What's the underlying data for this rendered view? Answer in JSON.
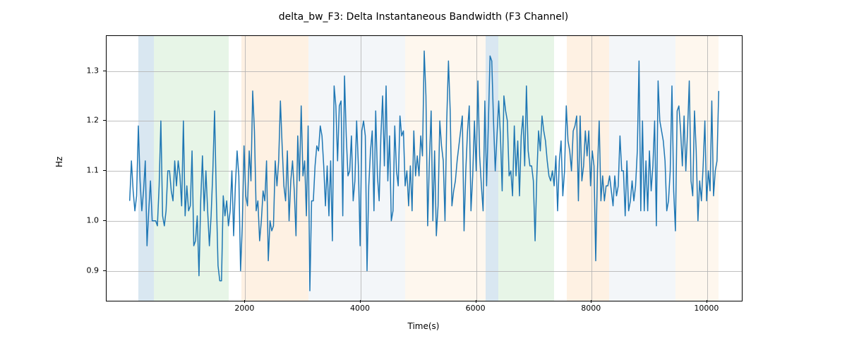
{
  "chart_data": {
    "type": "line",
    "title": "delta_bw_F3: Delta Instantaneous Bandwidth (F3 Channel)",
    "xlabel": "Time(s)",
    "ylabel": "Hz",
    "xlim": [
      -400,
      10600
    ],
    "ylim": [
      0.84,
      1.37
    ],
    "xticks": [
      2000,
      4000,
      6000,
      8000,
      10000
    ],
    "yticks": [
      0.9,
      1.0,
      1.1,
      1.2,
      1.3
    ],
    "bands": [
      {
        "x0": 150,
        "x1": 420,
        "color": "#8ab3d4"
      },
      {
        "x0": 420,
        "x1": 1720,
        "color": "#b3e0b3"
      },
      {
        "x0": 1940,
        "x1": 3100,
        "color": "#fbd4a8"
      },
      {
        "x0": 3100,
        "x1": 4770,
        "color": "#d9e4ed"
      },
      {
        "x0": 4770,
        "x1": 6160,
        "color": "#fce6c9"
      },
      {
        "x0": 6160,
        "x1": 6380,
        "color": "#8ab3d4"
      },
      {
        "x0": 6380,
        "x1": 7350,
        "color": "#b3e0b3"
      },
      {
        "x0": 7570,
        "x1": 8300,
        "color": "#fbd4a8"
      },
      {
        "x0": 8300,
        "x1": 9450,
        "color": "#d9e4ed"
      },
      {
        "x0": 9450,
        "x1": 10200,
        "color": "#fce6c9"
      }
    ],
    "x": [
      0,
      30,
      60,
      90,
      120,
      150,
      180,
      210,
      240,
      270,
      300,
      330,
      360,
      390,
      420,
      450,
      480,
      510,
      540,
      570,
      600,
      630,
      660,
      690,
      720,
      750,
      780,
      810,
      840,
      870,
      900,
      930,
      960,
      990,
      1020,
      1050,
      1080,
      1110,
      1140,
      1170,
      1200,
      1230,
      1260,
      1290,
      1320,
      1350,
      1380,
      1410,
      1440,
      1470,
      1500,
      1530,
      1560,
      1590,
      1620,
      1650,
      1680,
      1710,
      1740,
      1770,
      1800,
      1830,
      1860,
      1890,
      1920,
      1950,
      1980,
      2010,
      2040,
      2070,
      2100,
      2130,
      2160,
      2190,
      2220,
      2250,
      2280,
      2310,
      2340,
      2370,
      2400,
      2430,
      2460,
      2490,
      2520,
      2550,
      2580,
      2610,
      2640,
      2670,
      2700,
      2730,
      2760,
      2790,
      2820,
      2850,
      2880,
      2910,
      2940,
      2970,
      3000,
      3030,
      3060,
      3090,
      3120,
      3150,
      3180,
      3210,
      3240,
      3270,
      3300,
      3330,
      3360,
      3390,
      3420,
      3450,
      3480,
      3510,
      3540,
      3570,
      3600,
      3630,
      3660,
      3690,
      3720,
      3750,
      3780,
      3810,
      3840,
      3870,
      3900,
      3930,
      3960,
      3990,
      4020,
      4050,
      4080,
      4110,
      4140,
      4170,
      4200,
      4230,
      4260,
      4290,
      4320,
      4350,
      4380,
      4410,
      4440,
      4470,
      4500,
      4530,
      4560,
      4590,
      4620,
      4650,
      4680,
      4710,
      4740,
      4770,
      4800,
      4830,
      4860,
      4890,
      4920,
      4950,
      4980,
      5010,
      5040,
      5070,
      5100,
      5130,
      5160,
      5190,
      5220,
      5250,
      5280,
      5310,
      5340,
      5370,
      5400,
      5430,
      5460,
      5490,
      5520,
      5550,
      5580,
      5610,
      5640,
      5670,
      5700,
      5730,
      5760,
      5790,
      5820,
      5850,
      5880,
      5910,
      5940,
      5970,
      6000,
      6030,
      6060,
      6090,
      6120,
      6150,
      6180,
      6210,
      6240,
      6270,
      6300,
      6330,
      6360,
      6390,
      6420,
      6450,
      6480,
      6510,
      6540,
      6570,
      6600,
      6630,
      6660,
      6690,
      6720,
      6750,
      6780,
      6810,
      6840,
      6870,
      6900,
      6930,
      6960,
      6990,
      7020,
      7050,
      7080,
      7110,
      7140,
      7170,
      7200,
      7230,
      7260,
      7290,
      7320,
      7350,
      7380,
      7410,
      7440,
      7470,
      7500,
      7530,
      7560,
      7590,
      7620,
      7650,
      7680,
      7710,
      7740,
      7770,
      7800,
      7830,
      7860,
      7890,
      7920,
      7950,
      7980,
      8010,
      8040,
      8070,
      8100,
      8130,
      8160,
      8190,
      8220,
      8250,
      8280,
      8310,
      8340,
      8370,
      8400,
      8430,
      8460,
      8490,
      8520,
      8550,
      8580,
      8610,
      8640,
      8670,
      8700,
      8730,
      8760,
      8790,
      8820,
      8850,
      8880,
      8910,
      8940,
      8970,
      9000,
      9030,
      9060,
      9090,
      9120,
      9150,
      9180,
      9210,
      9240,
      9270,
      9300,
      9330,
      9360,
      9390,
      9420,
      9450,
      9480,
      9510,
      9540,
      9570,
      9600,
      9630,
      9660,
      9690,
      9720,
      9750,
      9780,
      9810,
      9840,
      9870,
      9900,
      9930,
      9960,
      9990,
      10020,
      10050,
      10080,
      10110,
      10140,
      10170,
      10200
    ],
    "values": [
      1.04,
      1.12,
      1.06,
      1.02,
      1.05,
      1.19,
      1.08,
      1.02,
      1.06,
      1.12,
      0.95,
      1.02,
      1.08,
      1.0,
      1.0,
      1.0,
      0.99,
      1.07,
      1.2,
      1.01,
      0.99,
      1.02,
      1.1,
      1.1,
      1.06,
      1.04,
      1.12,
      1.07,
      1.12,
      1.09,
      1.03,
      1.2,
      1.01,
      1.07,
      1.02,
      1.03,
      1.14,
      0.95,
      0.96,
      1.01,
      0.89,
      1.04,
      1.13,
      1.02,
      1.1,
      1.02,
      0.95,
      1.01,
      1.1,
      1.22,
      1.05,
      0.91,
      0.88,
      0.88,
      1.05,
      1.01,
      1.04,
      0.99,
      1.02,
      1.1,
      0.97,
      1.07,
      1.14,
      1.09,
      0.9,
      0.99,
      1.15,
      1.05,
      1.03,
      1.14,
      1.08,
      1.26,
      1.18,
      1.02,
      1.04,
      0.96,
      1.0,
      1.06,
      1.04,
      1.12,
      0.92,
      1.0,
      0.98,
      0.99,
      1.12,
      1.07,
      1.12,
      1.24,
      1.15,
      1.07,
      1.04,
      1.14,
      1.0,
      1.08,
      1.12,
      1.06,
      0.97,
      1.17,
      1.08,
      1.23,
      1.09,
      1.12,
      1.01,
      1.19,
      0.86,
      1.04,
      1.04,
      1.11,
      1.15,
      1.14,
      1.19,
      1.17,
      1.11,
      1.03,
      1.11,
      1.01,
      1.12,
      0.96,
      1.27,
      1.23,
      1.12,
      1.23,
      1.24,
      1.01,
      1.29,
      1.17,
      1.09,
      1.1,
      1.17,
      1.04,
      1.08,
      1.2,
      1.11,
      0.95,
      1.18,
      1.2,
      1.17,
      0.9,
      1.07,
      1.14,
      1.18,
      1.02,
      1.22,
      1.09,
      1.04,
      1.17,
      1.25,
      1.11,
      1.27,
      1.08,
      1.17,
      1.0,
      1.02,
      1.19,
      1.1,
      1.07,
      1.21,
      1.17,
      1.18,
      1.07,
      1.1,
      1.03,
      1.11,
      1.02,
      1.18,
      1.09,
      1.13,
      1.09,
      1.17,
      1.13,
      1.34,
      1.25,
      0.99,
      1.12,
      1.22,
      1.0,
      1.14,
      0.97,
      1.03,
      1.2,
      1.15,
      1.12,
      1.0,
      1.2,
      1.32,
      1.22,
      1.03,
      1.06,
      1.08,
      1.12,
      1.15,
      1.18,
      1.21,
      0.98,
      1.1,
      1.18,
      1.23,
      1.02,
      1.09,
      1.2,
      1.1,
      1.28,
      1.13,
      1.07,
      1.02,
      1.24,
      1.07,
      1.19,
      1.33,
      1.32,
      1.2,
      1.1,
      1.17,
      1.24,
      1.17,
      1.06,
      1.25,
      1.22,
      1.2,
      1.09,
      1.1,
      1.05,
      1.19,
      1.09,
      1.16,
      1.05,
      1.17,
      1.21,
      1.11,
      1.27,
      1.14,
      1.11,
      1.11,
      1.08,
      0.96,
      1.09,
      1.18,
      1.14,
      1.21,
      1.18,
      1.16,
      1.12,
      1.09,
      1.08,
      1.1,
      1.07,
      1.13,
      1.02,
      1.12,
      1.16,
      1.05,
      1.1,
      1.23,
      1.16,
      1.14,
      1.1,
      1.18,
      1.19,
      1.21,
      1.04,
      1.21,
      1.08,
      1.11,
      1.18,
      1.13,
      1.18,
      1.07,
      1.14,
      1.11,
      0.92,
      1.1,
      1.2,
      1.04,
      1.09,
      1.04,
      1.07,
      1.07,
      1.09,
      1.06,
      1.03,
      1.09,
      1.05,
      1.07,
      1.17,
      1.1,
      1.1,
      1.01,
      1.12,
      1.02,
      1.04,
      1.08,
      1.04,
      1.07,
      1.14,
      1.32,
      1.02,
      1.2,
      1.02,
      1.12,
      1.02,
      1.14,
      1.06,
      1.11,
      1.2,
      0.99,
      1.28,
      1.2,
      1.18,
      1.16,
      1.12,
      1.02,
      1.04,
      1.1,
      1.27,
      1.06,
      0.98,
      1.22,
      1.23,
      1.18,
      1.11,
      1.21,
      1.1,
      1.18,
      1.28,
      1.08,
      1.05,
      1.22,
      1.14,
      1.0,
      1.08,
      1.04,
      1.11,
      1.2,
      1.04,
      1.1,
      1.06,
      1.24,
      1.05,
      1.1,
      1.12,
      1.26
    ]
  }
}
